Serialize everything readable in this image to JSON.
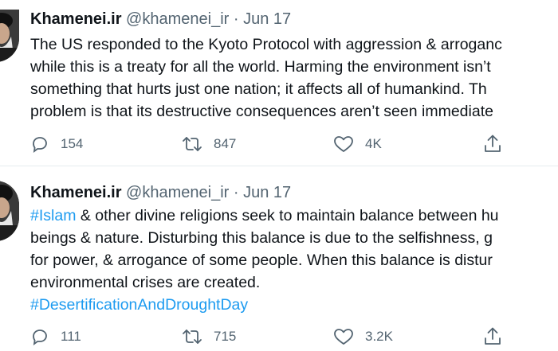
{
  "tweets": [
    {
      "author_name": "Khamenei.ir",
      "handle": "@khamenei_ir",
      "separator": "·",
      "date": "Jun 17",
      "lines": [
        "The US responded to the Kyoto Protocol with aggression & arroganc",
        "while this is a treaty for all the world. Harming the environment isn’t",
        "something that hurts just one nation; it affects all of humankind. Th",
        "problem is that its destructive consequences aren’t seen immediate"
      ],
      "replies": "154",
      "retweets": "847",
      "likes": "4K"
    },
    {
      "author_name": "Khamenei.ir",
      "handle": "@khamenei_ir",
      "separator": "·",
      "date": "Jun 17",
      "hashtag_start": "#Islam",
      "line1_rest": " & other divine religions seek to maintain balance between hu",
      "lines": [
        "beings & nature. Disturbing this balance is due to the selfishness, g",
        "for power, & arrogance of some people. When this balance is distur",
        "environmental crises are created."
      ],
      "hashtag_end": "#DesertificationAndDroughtDay",
      "replies": "111",
      "retweets": "715",
      "likes": "3.2K"
    }
  ],
  "icons": {
    "reply": "reply-icon",
    "retweet": "retweet-icon",
    "like": "heart-icon",
    "share": "share-icon"
  },
  "colors": {
    "text": "#0f1419",
    "secondary": "#536471",
    "link": "#1d9bf0",
    "divider": "#e6ecf0"
  }
}
